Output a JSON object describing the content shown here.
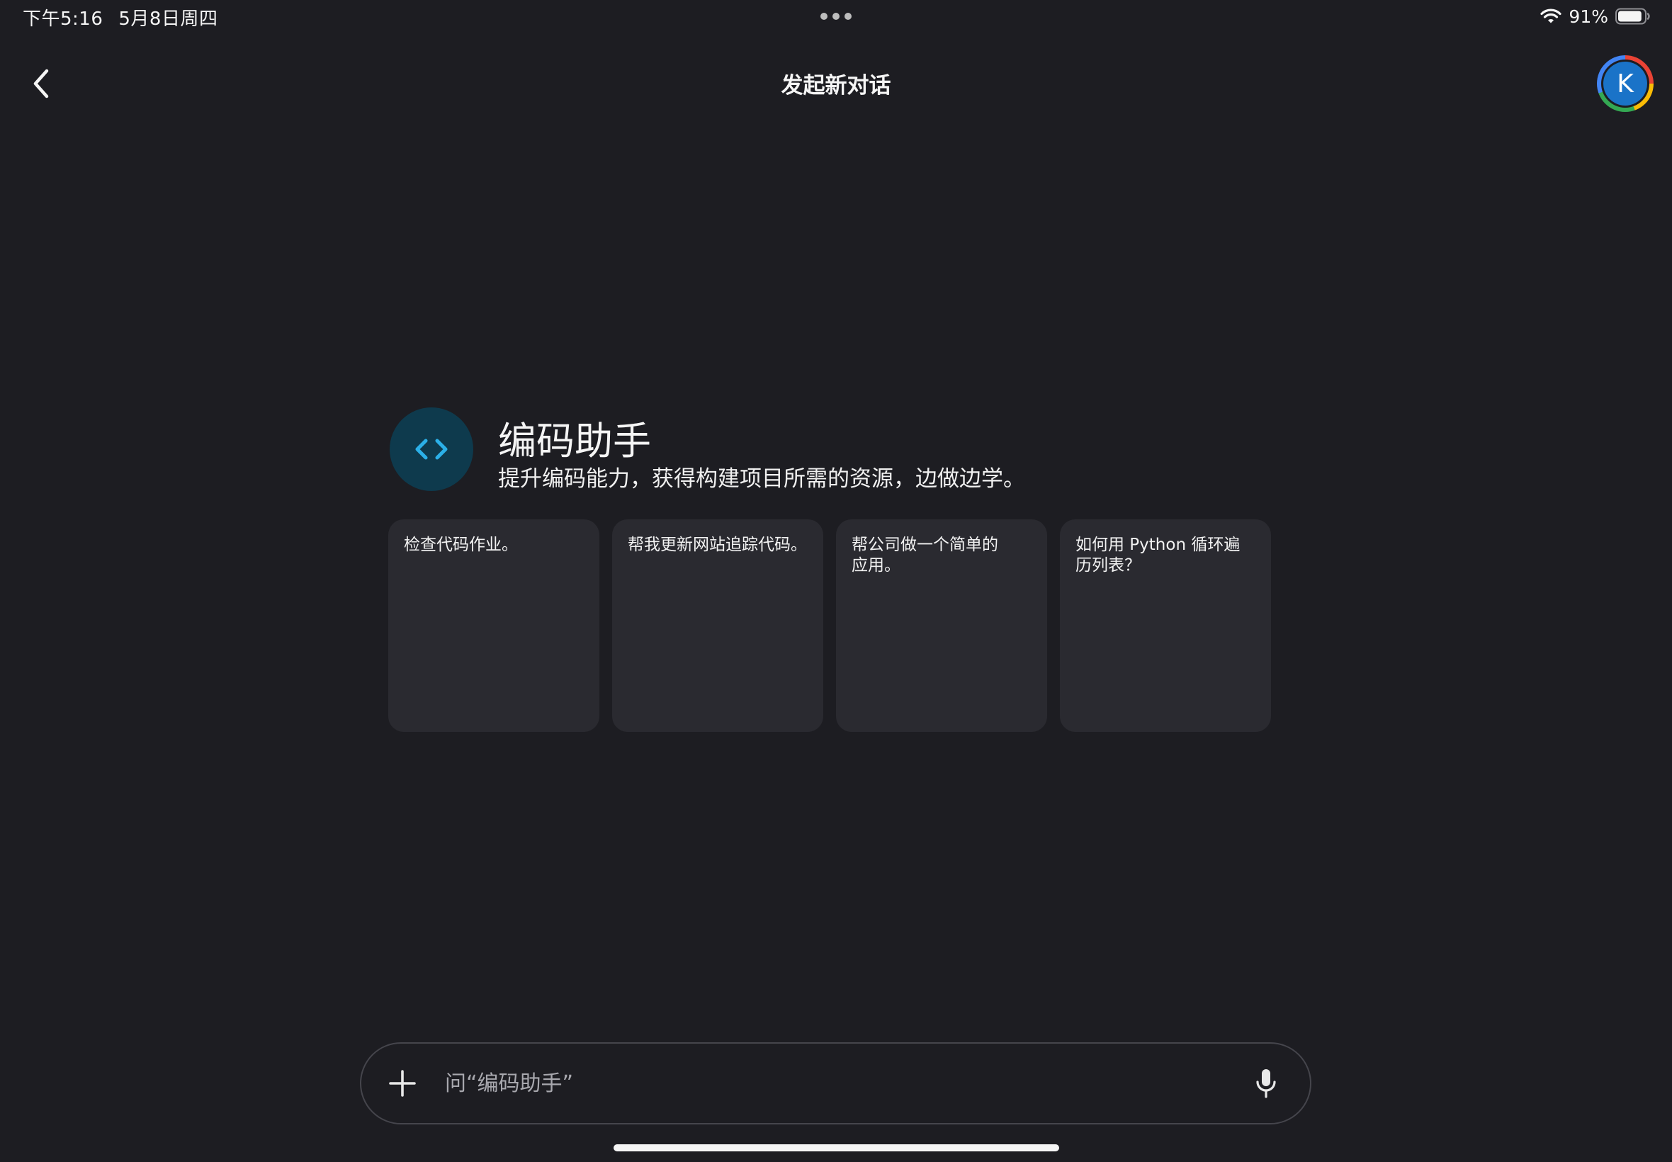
{
  "status_bar": {
    "time": "下午5:16",
    "date": "5月8日周四",
    "battery_percent": "91%",
    "battery_level": 0.91
  },
  "header": {
    "title": "发起新对话",
    "avatar_initial": "K"
  },
  "gem": {
    "icon": "code-brackets-icon",
    "name": "编码助手",
    "description": "提升编码能力，获得构建项目所需的资源，边做边学。"
  },
  "suggestions": [
    {
      "lines": [
        "检查代码作业。"
      ]
    },
    {
      "lines": [
        "帮我更新网站追踪代码。"
      ]
    },
    {
      "lines": [
        "帮公司做一个简单的",
        "应用。"
      ]
    },
    {
      "lines": [
        "如何用 Python 循环遍",
        "历列表？"
      ]
    }
  ],
  "input": {
    "placeholder": "问“编码助手”",
    "value": ""
  },
  "colors": {
    "background": "#1d1d22",
    "card": "#2a2a30",
    "gem_icon_bg": "#0e3a4d",
    "gem_icon_fg": "#2bb0e8",
    "avatar": "#1a73c8"
  }
}
